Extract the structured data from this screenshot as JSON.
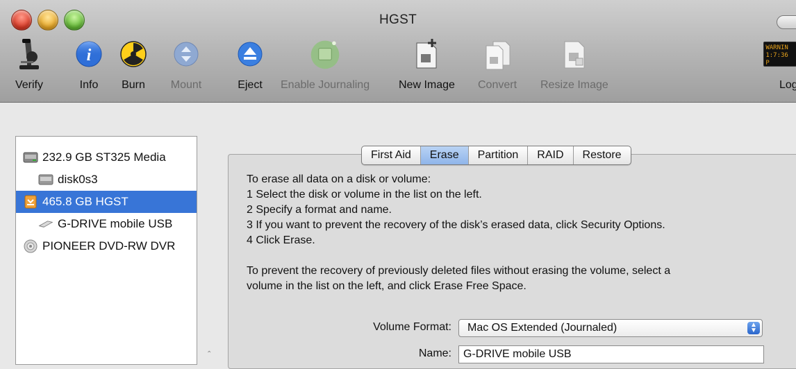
{
  "window": {
    "title": "HGST"
  },
  "toolbar": {
    "verify": "Verify",
    "info": "Info",
    "burn": "Burn",
    "mount": "Mount",
    "eject": "Eject",
    "enable_journaling": "Enable Journaling",
    "new_image": "New Image",
    "convert": "Convert",
    "resize_image": "Resize Image",
    "log": "Log",
    "log_badge_line1": "WARNIN",
    "log_badge_line2": "1:7:36 P"
  },
  "sidebar": {
    "items": [
      {
        "label": "232.9 GB ST325 Media",
        "icon": "internal-disk-icon",
        "indent": false,
        "selected": false
      },
      {
        "label": "disk0s3",
        "icon": "volume-icon",
        "indent": true,
        "selected": false
      },
      {
        "label": "465.8 GB HGST",
        "icon": "external-disk-icon",
        "indent": false,
        "selected": true
      },
      {
        "label": "G-DRIVE mobile USB",
        "icon": "usb-volume-icon",
        "indent": true,
        "selected": false
      },
      {
        "label": "PIONEER DVD-RW DVR",
        "icon": "optical-drive-icon",
        "indent": false,
        "selected": false
      }
    ]
  },
  "tabs": [
    {
      "label": "First Aid",
      "active": false
    },
    {
      "label": "Erase",
      "active": true
    },
    {
      "label": "Partition",
      "active": false
    },
    {
      "label": "RAID",
      "active": false
    },
    {
      "label": "Restore",
      "active": false
    }
  ],
  "erase": {
    "intro": "To erase all data on a disk or volume:",
    "step1": "1 Select the disk or volume in the list on the left.",
    "step2": "2 Specify a format and name.",
    "step3": "3 If you want to prevent the recovery of the disk’s erased data, click Security Options.",
    "step4": "4 Click Erase.",
    "free_space_1": "To prevent the recovery of previously deleted files without erasing the volume, select a",
    "free_space_2": "volume in the list on the left, and click Erase Free Space.",
    "format_label": "Volume Format:",
    "format_value": "Mac OS Extended (Journaled)",
    "name_label": "Name:",
    "name_value": "G-DRIVE mobile USB"
  },
  "colors": {
    "selection": "#3875d7",
    "active_tab": "#9fc0ee"
  }
}
